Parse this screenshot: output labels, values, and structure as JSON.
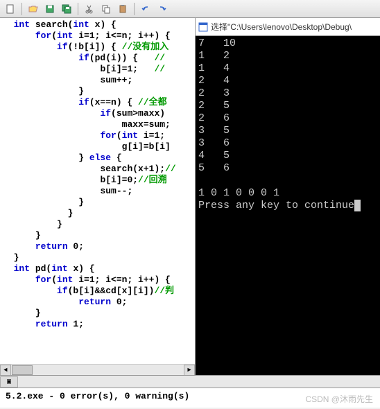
{
  "toolbar": {
    "icons": [
      "new",
      "open",
      "save",
      "saveall",
      "cut",
      "copy",
      "paste",
      "undo",
      "redo"
    ]
  },
  "terminal": {
    "title_prefix": "选择",
    "title_path": "\"C:\\Users\\lenovo\\Desktop\\Debug\\",
    "lines": [
      "7   10",
      "1   2",
      "1   4",
      "2   4",
      "2   3",
      "2   5",
      "2   6",
      "3   5",
      "3   6",
      "4   5",
      "5   6",
      "",
      "1 0 1 0 0 0 1",
      "Press any key to continue"
    ]
  },
  "code": {
    "l01_a": "int",
    "l01_b": " search(",
    "l01_c": "int",
    "l01_d": " x) {",
    "l02_a": "for",
    "l02_b": "(",
    "l02_c": "int",
    "l02_d": " i=1; i<=n; i++) {",
    "l03_a": "if",
    "l03_b": "(!b[i]) { ",
    "l03_c": "//没有加入",
    "l04_a": "if",
    "l04_b": "(pd(i)) {   ",
    "l04_c": "//",
    "l05": "b[i]=1;   ",
    "l05_c": "//",
    "l06": "sum++;",
    "l07": "}",
    "l08_a": "if",
    "l08_b": "(x==n) { ",
    "l08_c": "//全都",
    "l09_a": "if",
    "l09_b": "(sum>maxx)",
    "l10": "maxx=sum;",
    "l11_a": "for",
    "l11_b": "(",
    "l11_c": "int",
    "l11_d": " i=1;",
    "l12": "g[i]=b[i]",
    "l13_a": "} ",
    "l13_b": "else",
    "l13_c": " {",
    "l14": "search(x+1);",
    "l14_c": "//",
    "l15": "b[i]=0;",
    "l15_c": "//回溯",
    "l16": "sum--;",
    "l17": "}",
    "l18": "}",
    "l19": "}",
    "l20": "}",
    "l21_a": "return",
    "l21_b": " 0;",
    "l22": "}",
    "l23_a": "int",
    "l23_b": " pd(",
    "l23_c": "int",
    "l23_d": " x) {",
    "l24_a": "for",
    "l24_b": "(",
    "l24_c": "int",
    "l24_d": " i=1; i<=n; i++) {",
    "l25_a": "if",
    "l25_b": "(b[i]&&cd[x][i])",
    "l25_c": "//判",
    "l26_a": "return",
    "l26_b": " 0;",
    "l27": "}",
    "l28_a": "return",
    "l28_b": " 1;"
  },
  "output": {
    "text": "5.2.exe - 0 error(s), 0 warning(s)"
  },
  "watermark": "CSDN @沐雨先生"
}
